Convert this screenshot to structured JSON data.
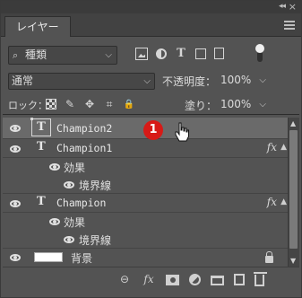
{
  "panel": {
    "collapse": "◂◂",
    "close": "×",
    "tab_label": "レイヤー"
  },
  "filter": {
    "kind_label": "種類",
    "search_glyph": "⌕",
    "chev": "⌵",
    "text_glyph": "T"
  },
  "blend": {
    "mode": "通常",
    "chev": "⌵",
    "opacity_label": "不透明度：",
    "opacity_value": "100%"
  },
  "lock": {
    "label": "ロック：",
    "brush_glyph": "✎",
    "move_glyph": "✥",
    "artboard_glyph": "⌗",
    "padlock_glyph": "🔒",
    "fill_label": "塗り：",
    "fill_value": "100%"
  },
  "layers": [
    {
      "name": "Champion2",
      "selected": true
    },
    {
      "name": "Champion1",
      "fx": "fx",
      "effects_label": "効果",
      "effect": "境界線"
    },
    {
      "name": "Champion",
      "fx": "fx",
      "effects_label": "効果",
      "effect": "境界線"
    },
    {
      "name": "背景",
      "locked": true
    }
  ],
  "text_layer_glyph": "T",
  "annotation": {
    "badge": "1"
  },
  "scroll": {
    "up": "▲",
    "down": "▼"
  },
  "bottom": {
    "link_glyph": "⊖",
    "fx_label": "fx"
  }
}
